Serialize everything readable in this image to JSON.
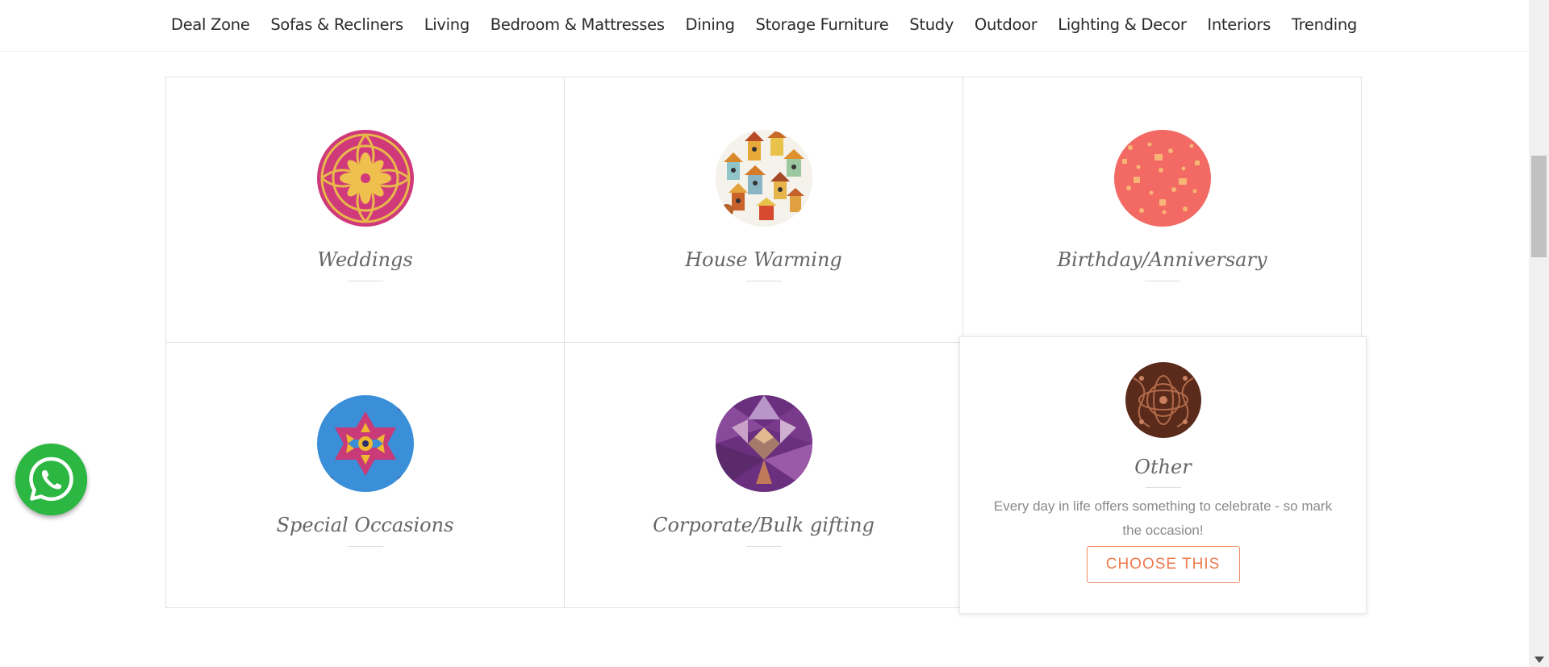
{
  "nav": {
    "items": [
      "Deal Zone",
      "Sofas & Recliners",
      "Living",
      "Bedroom & Mattresses",
      "Dining",
      "Storage Furniture",
      "Study",
      "Outdoor",
      "Lighting & Decor",
      "Interiors",
      "Trending"
    ]
  },
  "occasions": [
    {
      "title": "Weddings",
      "icon": "weddings-pattern-icon"
    },
    {
      "title": "House Warming",
      "icon": "birdhouses-pattern-icon"
    },
    {
      "title": "Birthday/Anniversary",
      "icon": "birthday-pattern-icon"
    },
    {
      "title": "Special Occasions",
      "icon": "kaleidoscope-pattern-icon"
    },
    {
      "title": "Corporate/Bulk gifting",
      "icon": "crystal-pattern-icon"
    }
  ],
  "other": {
    "title": "Other",
    "description": "Every day in life offers something to celebrate - so mark the occasion!",
    "button": "CHOOSE THIS",
    "icon": "paisley-pattern-icon"
  },
  "colors": {
    "accent": "#ef7a4e",
    "whatsapp": "#2bb741"
  },
  "floating": {
    "whatsapp_icon": "whatsapp-icon"
  }
}
